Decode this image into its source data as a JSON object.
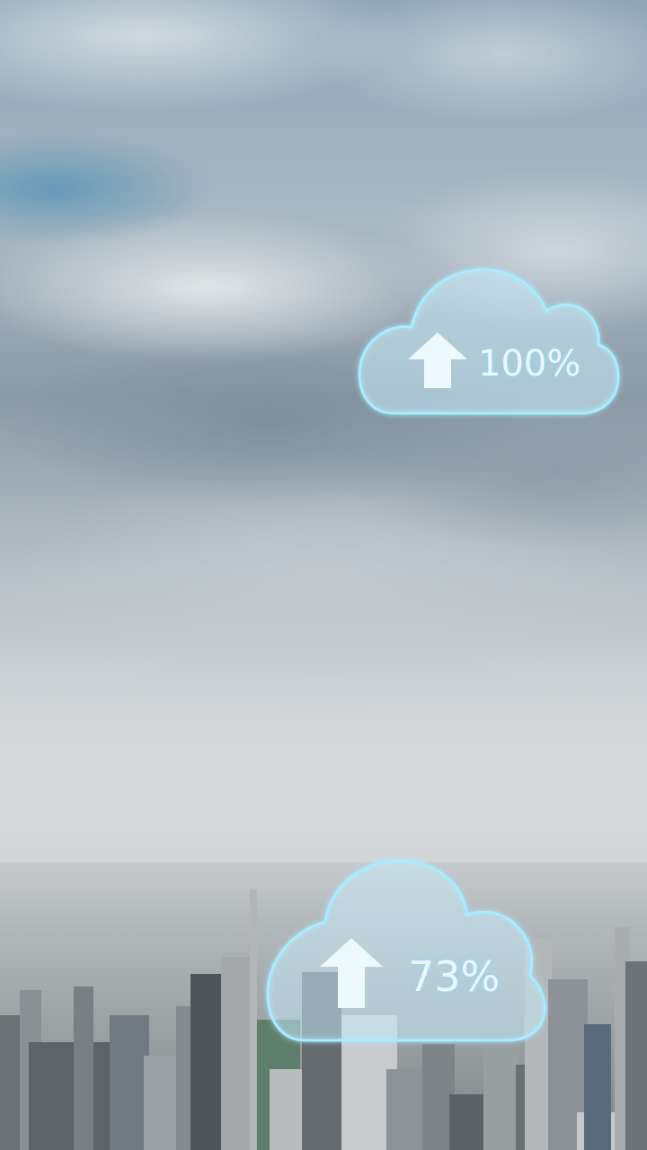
{
  "scene": {
    "description_icons": [
      "cloud-upload-icon",
      "cloud-upload-icon"
    ],
    "colors": {
      "glow": "#9fe6ff",
      "cloud_fill": "rgba(200,235,250,0.35)",
      "arrow": "#eef9ff"
    }
  },
  "uploads": [
    {
      "icon": "cloud-upload-icon",
      "label": "100%",
      "progress": 1.0
    },
    {
      "icon": "cloud-upload-icon",
      "label": "73%",
      "progress": 0.73
    }
  ]
}
